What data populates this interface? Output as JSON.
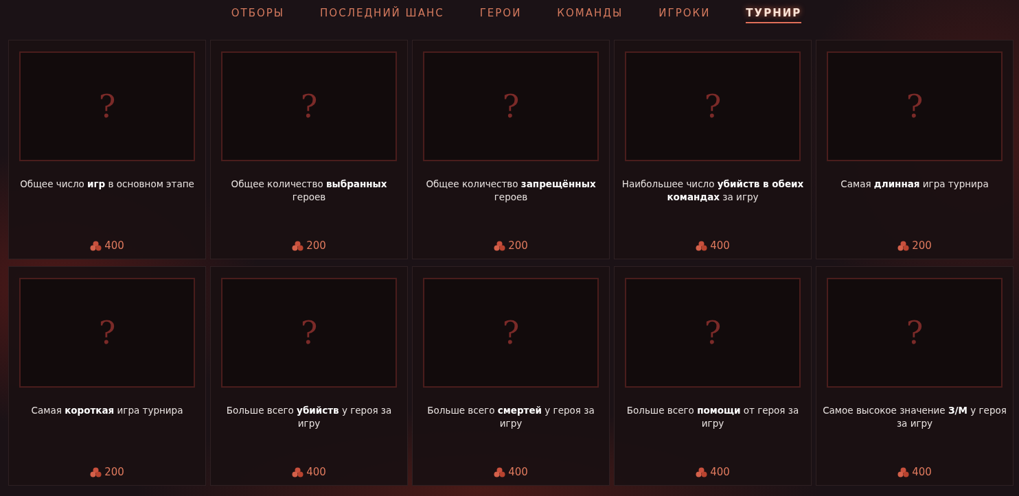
{
  "nav": [
    {
      "label": "ОТБОРЫ",
      "selected": false
    },
    {
      "label": "ПОСЛЕДНИЙ ШАНС",
      "selected": false
    },
    {
      "label": "ГЕРОИ",
      "selected": false
    },
    {
      "label": "КОМАНДЫ",
      "selected": false
    },
    {
      "label": "ИГРОКИ",
      "selected": false
    },
    {
      "label": "ТУРНИР",
      "selected": true
    }
  ],
  "cards": [
    {
      "mark": "?",
      "question": "Общее число **игр** в основном этапе",
      "points": "400"
    },
    {
      "mark": "?",
      "question": "Общее количество **выбранных** героев",
      "points": "200"
    },
    {
      "mark": "?",
      "question": "Общее количество **запрещённых** героев",
      "points": "200"
    },
    {
      "mark": "?",
      "question": "Наибольшее число **убийств в обеих командах** за игру",
      "points": "400"
    },
    {
      "mark": "?",
      "question": "Самая **длинная** игра турнира",
      "points": "200"
    },
    {
      "mark": "?",
      "question": "Самая **короткая** игра турнира",
      "points": "200"
    },
    {
      "mark": "?",
      "question": "Больше всего **убийств** у героя за игру",
      "points": "400"
    },
    {
      "mark": "?",
      "question": "Больше всего **смертей** у героя за игру",
      "points": "400"
    },
    {
      "mark": "?",
      "question": "Больше всего **помощи** от героя за игру",
      "points": "400"
    },
    {
      "mark": "?",
      "question": "Самое высокое значение **З/М** у героя за игру",
      "points": "400"
    }
  ]
}
